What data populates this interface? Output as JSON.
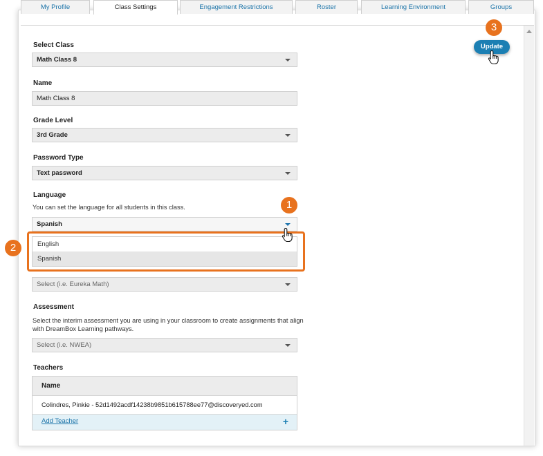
{
  "tabs": [
    {
      "label": "My Profile"
    },
    {
      "label": "Class Settings"
    },
    {
      "label": "Engagement Restrictions"
    },
    {
      "label": "Roster"
    },
    {
      "label": "Learning Environment"
    },
    {
      "label": "Groups"
    }
  ],
  "form": {
    "select_class": {
      "label": "Select Class",
      "value": "Math Class 8"
    },
    "name": {
      "label": "Name",
      "value": "Math Class 8"
    },
    "grade_level": {
      "label": "Grade Level",
      "value": "3rd Grade"
    },
    "password_type": {
      "label": "Password Type",
      "value": "Text password"
    },
    "language": {
      "label": "Language",
      "help": "You can set the language for all students in this class.",
      "value": "Spanish",
      "options": [
        "English",
        "Spanish"
      ]
    },
    "curriculum": {
      "value": "Select (i.e. Eureka Math)"
    },
    "assessment": {
      "label": "Assessment",
      "help": "Select the interim assessment you are using in your classroom to create assignments that align with DreamBox Learning pathways.",
      "value": "Select (i.e. NWEA)"
    }
  },
  "teachers": {
    "label": "Teachers",
    "column": "Name",
    "rows": [
      "Colindres, Pinkie - 52d1492acdf14238b9851b615788ee77@discoveryed.com"
    ],
    "add_label": "Add Teacher",
    "add_icon": "+"
  },
  "update_label": "Update",
  "callouts": [
    "1",
    "2",
    "3"
  ],
  "colors": {
    "accent": "#e8721e",
    "primary": "#1b7fb3",
    "link": "#1a73a8"
  }
}
